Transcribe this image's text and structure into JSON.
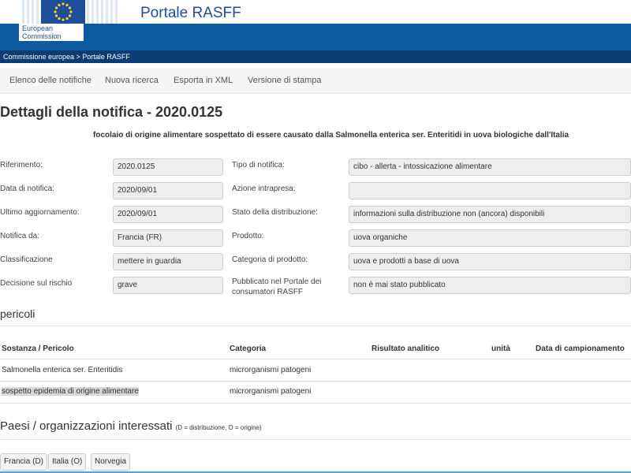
{
  "header": {
    "org_label": "European Commission",
    "portal_title": "Portale RASFF",
    "breadcrumb": "Commissione europea > Portale RASFF",
    "flag_color": "#1f4e9b",
    "bar_color": "#0d5aa0"
  },
  "nav": {
    "items": [
      "Elenco delle notifiche",
      "Nuova ricerca",
      "Esporta in XML",
      "Versione di stampa"
    ]
  },
  "page": {
    "title": "Dettagli della notifica - 2020.0125",
    "subject": "focolaio di origine alimentare sospettato di essere causato dalla Salmonella enterica ser. Enteritidi in uova biologiche dall'Italia"
  },
  "details": {
    "left": [
      {
        "label": "Riferimento:",
        "value": "2020.0125"
      },
      {
        "label": "Data di notifica:",
        "value": "2020/09/01"
      },
      {
        "label": "Ultimo aggiornamento:",
        "value": "2020/09/01"
      },
      {
        "label": "Notifica da:",
        "value": "Francia (FR)"
      },
      {
        "label": "Classificazione",
        "value": "mettere in guardia"
      },
      {
        "label": "Decisione sul rischio",
        "value": "grave"
      }
    ],
    "right": [
      {
        "label": "Tipo di notifica:",
        "value": "cibo - allerta - intossicazione alimentare"
      },
      {
        "label": "Azione intrapresa:",
        "value": ""
      },
      {
        "label": "Stato della distribuzione:",
        "value": "informazioni sulla distribuzione non (ancora) disponibili"
      },
      {
        "label": "Prodotto:",
        "value": "uova organiche"
      },
      {
        "label": "Categoria di prodotto:",
        "value": "uova e prodotti a base di uova"
      },
      {
        "label": "Pubblicato nel Portale dei consumatori RASFF",
        "value": "non è mai stato pubblicato"
      }
    ]
  },
  "hazards": {
    "title": "pericoli",
    "columns": [
      "Sostanza / Pericolo",
      "Categoria",
      "Risultato analitico",
      "unità",
      "Data di campionamento"
    ],
    "rows": [
      [
        "Salmonella enterica ser. Enteritidis",
        "microrganismi patogeni"
      ],
      [
        "sospetto epidemia di origine alimentare",
        "microrganismi patogeni"
      ]
    ]
  },
  "countries": {
    "title": "Paesi / organizzazioni interessati",
    "note": "(D = distribuzione, O = origine)",
    "items": [
      "Francia (D)",
      "Italia (O)",
      "Norvegia"
    ]
  }
}
